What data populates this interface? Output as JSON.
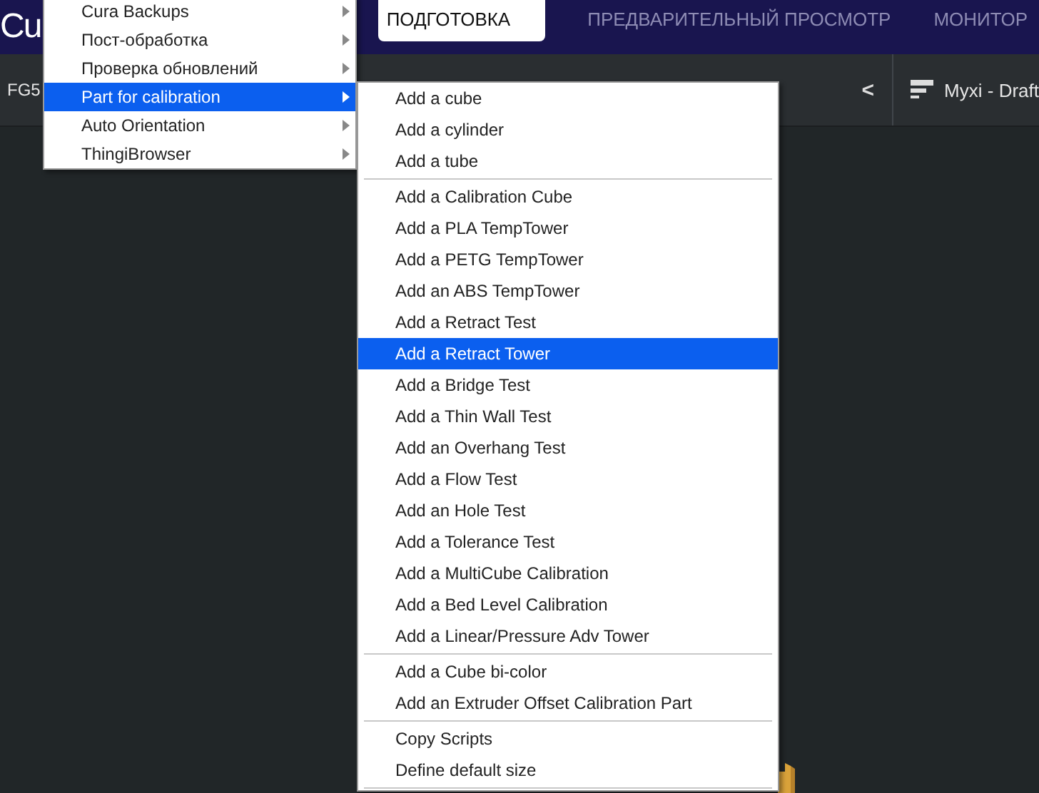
{
  "header": {
    "logo": "Cu",
    "tabs": [
      {
        "label": "ПОДГОТОВКА",
        "selected": true
      },
      {
        "label": "ПРЕДВАРИТЕЛЬНЫЙ ПРОСМОТР",
        "selected": false
      },
      {
        "label": "МОНИТОР",
        "selected": false
      }
    ]
  },
  "toolbar": {
    "printer": "FG5",
    "collapse": "<",
    "profile": "Myxi - Draft"
  },
  "menu": {
    "items": [
      {
        "label": "Cura Backups",
        "selected": false,
        "has_submenu": true
      },
      {
        "label": "Пост-обработка",
        "selected": false,
        "has_submenu": true
      },
      {
        "label": "Проверка обновлений",
        "selected": false,
        "has_submenu": true
      },
      {
        "label": "Part for calibration",
        "selected": true,
        "has_submenu": true
      },
      {
        "label": "Auto Orientation",
        "selected": false,
        "has_submenu": true
      },
      {
        "label": "ThingiBrowser",
        "selected": false,
        "has_submenu": true
      }
    ]
  },
  "submenu": {
    "items": [
      {
        "kind": "item",
        "label": "Add a cube",
        "selected": false
      },
      {
        "kind": "item",
        "label": "Add a cylinder",
        "selected": false
      },
      {
        "kind": "item",
        "label": "Add a tube",
        "selected": false
      },
      {
        "kind": "separator"
      },
      {
        "kind": "item",
        "label": "Add a Calibration Cube",
        "selected": false
      },
      {
        "kind": "item",
        "label": "Add a PLA TempTower",
        "selected": false
      },
      {
        "kind": "item",
        "label": "Add a PETG TempTower",
        "selected": false
      },
      {
        "kind": "item",
        "label": "Add an ABS TempTower",
        "selected": false
      },
      {
        "kind": "item",
        "label": "Add a Retract Test",
        "selected": false
      },
      {
        "kind": "item",
        "label": "Add a Retract Tower",
        "selected": true
      },
      {
        "kind": "item",
        "label": "Add a Bridge Test",
        "selected": false
      },
      {
        "kind": "item",
        "label": "Add a Thin Wall Test",
        "selected": false
      },
      {
        "kind": "item",
        "label": "Add an Overhang Test",
        "selected": false
      },
      {
        "kind": "item",
        "label": "Add a Flow Test",
        "selected": false
      },
      {
        "kind": "item",
        "label": "Add an Hole Test",
        "selected": false
      },
      {
        "kind": "item",
        "label": "Add a Tolerance Test",
        "selected": false
      },
      {
        "kind": "item",
        "label": "Add a MultiCube Calibration",
        "selected": false
      },
      {
        "kind": "item",
        "label": "Add a Bed Level Calibration",
        "selected": false
      },
      {
        "kind": "item",
        "label": "Add a Linear/Pressure Adv Tower",
        "selected": false
      },
      {
        "kind": "separator"
      },
      {
        "kind": "item",
        "label": "Add a Cube bi-color",
        "selected": false
      },
      {
        "kind": "item",
        "label": "Add an Extruder Offset Calibration Part",
        "selected": false
      },
      {
        "kind": "separator"
      },
      {
        "kind": "item",
        "label": "Copy Scripts",
        "selected": false
      },
      {
        "kind": "item",
        "label": "Define default size",
        "selected": false
      },
      {
        "kind": "separator"
      }
    ]
  }
}
